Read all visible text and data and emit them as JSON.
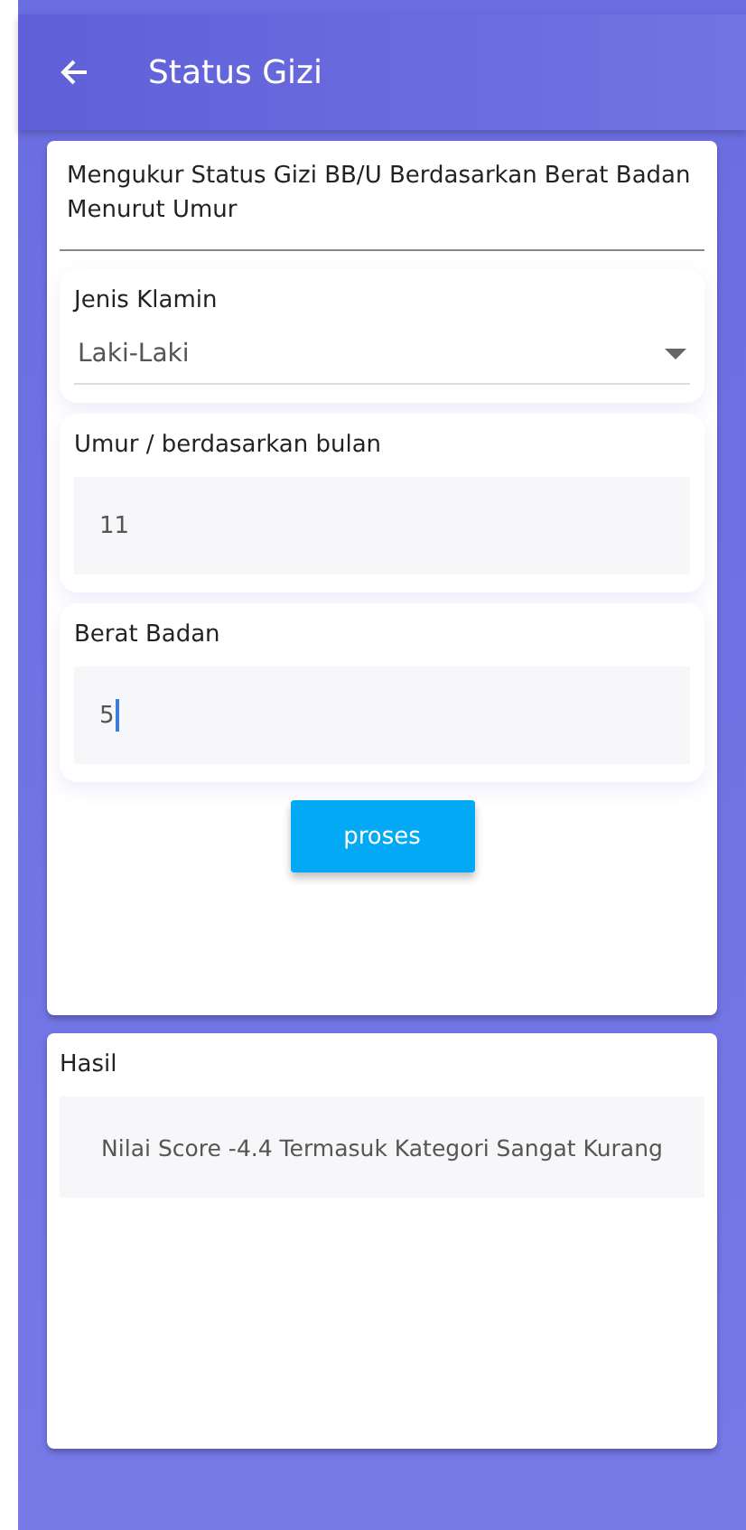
{
  "app_bar": {
    "title": "Status Gizi"
  },
  "form": {
    "heading": "Mengukur Status Gizi BB/U Berdasarkan Berat Badan Menurut Umur",
    "fields": [
      {
        "kind": "dropdown",
        "label": "Jenis Klamin",
        "value": "Laki-Laki",
        "focused": false
      },
      {
        "kind": "text",
        "label": "Umur / berdasarkan bulan",
        "value": "11",
        "focused": false
      },
      {
        "kind": "text",
        "label": "Berat Badan",
        "value": "5",
        "focused": true
      }
    ],
    "button": "proses"
  },
  "result": {
    "label": "Hasil",
    "text": "Nilai Score -4.4 Termasuk Kategori Sangat Kurang"
  }
}
